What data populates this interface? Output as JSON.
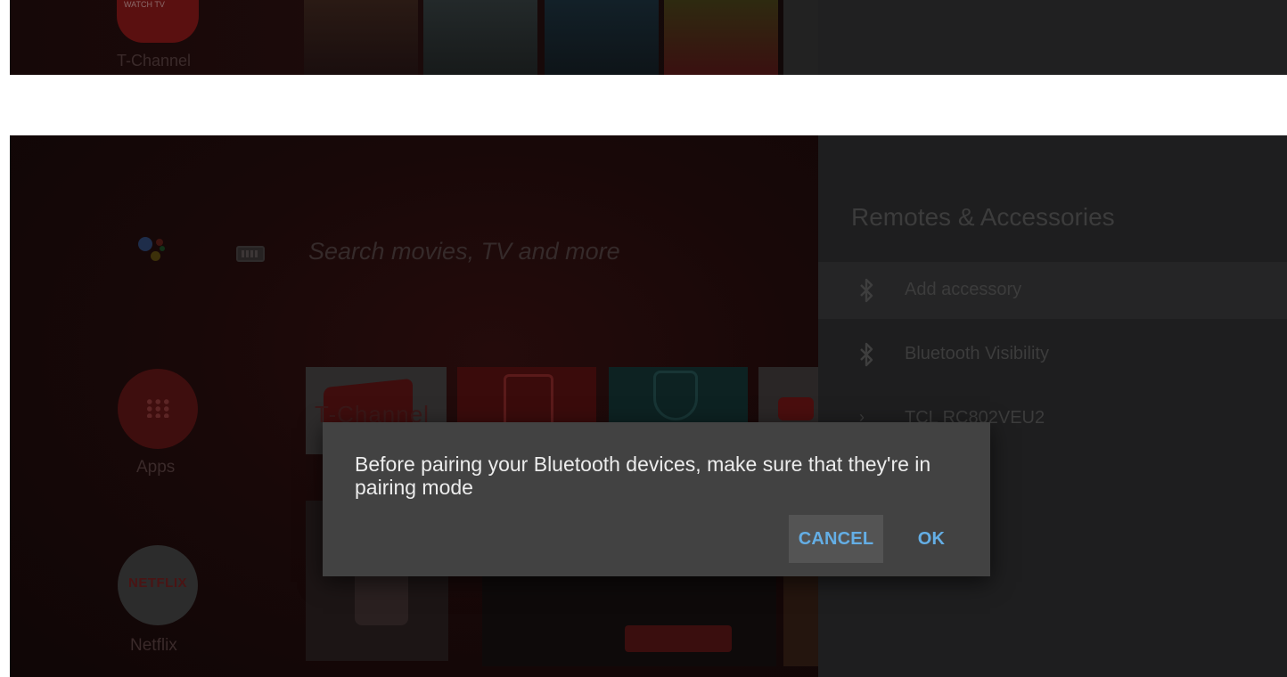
{
  "top_strip": {
    "channel_tile_text": "WATCH TV",
    "channel_label": "T-Channel"
  },
  "home": {
    "search_placeholder": "Search movies, TV and more",
    "side_items": [
      {
        "label": "Apps"
      },
      {
        "label": "Netflix",
        "logo_text": "NETFLIX"
      }
    ],
    "tiles": {
      "tchannel_text": "T-Channel"
    },
    "assistant_colors": [
      "#4285f4",
      "#ea4335",
      "#fbbc05",
      "#34a853"
    ]
  },
  "settings": {
    "title": "Remotes & Accessories",
    "items": [
      {
        "label": "Add accessory",
        "icon": "bluetooth-icon",
        "selected": true
      },
      {
        "label": "Bluetooth Visibility",
        "icon": "bluetooth-icon",
        "selected": false
      },
      {
        "label": "TCL RC802VEU2",
        "icon": "chevron-right-icon",
        "selected": false
      }
    ]
  },
  "dialog": {
    "message": "Before pairing your Bluetooth devices, make sure that they're in pairing mode",
    "cancel_label": "CANCEL",
    "ok_label": "OK",
    "accent_color": "#64aee5"
  }
}
